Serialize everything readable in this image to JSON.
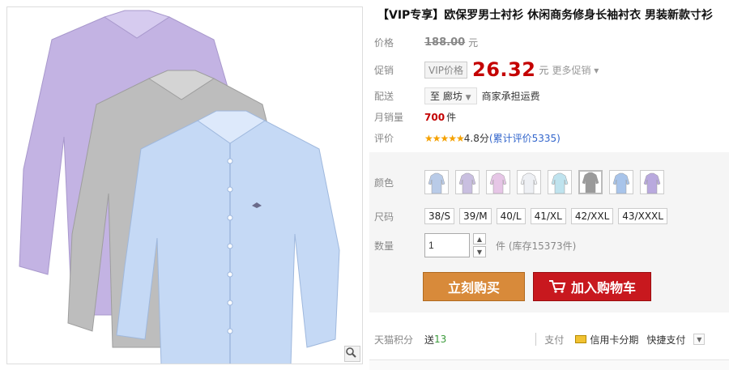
{
  "product": {
    "title": "【VIP专享】欧保罗男士衬衫 休闲商务修身长袖衬衣 男装新款寸衫"
  },
  "price": {
    "label": "价格",
    "original": "188.00",
    "unit": "元"
  },
  "promo": {
    "label": "促销",
    "tag": "VIP价格",
    "price": "26.32",
    "unit": "元",
    "more": "更多促销"
  },
  "delivery": {
    "label": "配送",
    "destination": "至 廊坊",
    "note": "商家承担运费"
  },
  "sales": {
    "label": "月销量",
    "count": "700",
    "unit": "件"
  },
  "rating": {
    "label": "评价",
    "stars": "★★★★★",
    "score": "4.8分",
    "reviews": "(累计评价5335)"
  },
  "color": {
    "label": "颜色",
    "swatches": [
      {
        "name": "light-blue",
        "hex": "#b9cbe8"
      },
      {
        "name": "lavender",
        "hex": "#c9bfe0"
      },
      {
        "name": "pink",
        "hex": "#e6c6e6"
      },
      {
        "name": "white",
        "hex": "#eef0f4"
      },
      {
        "name": "sky",
        "hex": "#bfe3ee"
      },
      {
        "name": "gray",
        "hex": "#9a9a9a"
      },
      {
        "name": "blue",
        "hex": "#a8c4ea"
      },
      {
        "name": "purple",
        "hex": "#b9a9de"
      }
    ]
  },
  "size": {
    "label": "尺码",
    "options": [
      "38/S",
      "39/M",
      "40/L",
      "41/XL",
      "42/XXL",
      "43/XXXL"
    ]
  },
  "quantity": {
    "label": "数量",
    "value": "1",
    "stock": "件 (库存15373件)"
  },
  "actions": {
    "buy": "立刻购买",
    "cart": "加入购物车"
  },
  "points": {
    "label": "天猫积分",
    "prefix": "送",
    "value": "13",
    "pay_label": "支付",
    "card": "信用卡分期",
    "quick": "快捷支付"
  },
  "colors": {
    "price_red": "#c40000",
    "buy_orange": "#d88a3a",
    "cart_red": "#c8181e"
  }
}
